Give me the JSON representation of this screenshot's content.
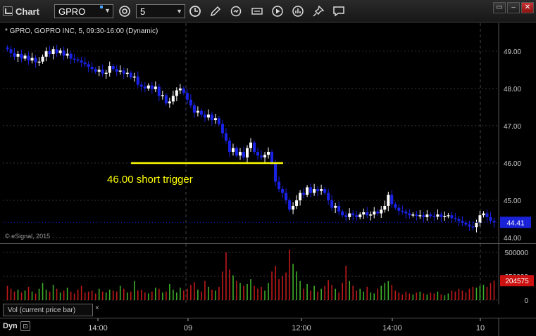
{
  "toolbar": {
    "title": "Chart",
    "symbol": "GPRO",
    "interval": "5",
    "icons": [
      "chart-icon",
      "link-settings-icon",
      "clock-icon",
      "pencil-draw-icon",
      "refresh-icon",
      "edit-label-icon",
      "play-icon",
      "bar-chart-icon",
      "pin-icon",
      "comment-icon"
    ],
    "window_buttons": [
      "restore",
      "minimize",
      "close"
    ]
  },
  "chart": {
    "heading": "* GPRO, GOPRO INC, 5, 09:30-16:00 (Dynamic)",
    "copyright": "© eSignal, 2015",
    "annotation": "46.00 short trigger",
    "annotation_color": "#ffff00",
    "trigger_price": 46.0,
    "last_price_label": "44.41",
    "last_price_color": "#1a22d8",
    "up_color": "#ffffff",
    "down_color": "#1a22e6"
  },
  "volume": {
    "label": "Vol (current price bar)",
    "close_symbol": "×",
    "last_volume_label": "204575",
    "last_volume_color": "#cc1111"
  },
  "time_axis": {
    "mode": "Dyn",
    "ticks": [
      "14:00",
      "09",
      "12:00",
      "14:00",
      "10"
    ]
  },
  "chart_data": [
    {
      "type": "candlestick",
      "title": "* GPRO, GOPRO INC, 5, 09:30-16:00 (Dynamic)",
      "ylabel": "",
      "ylim": [
        44.0,
        49.5
      ],
      "y_ticks": [
        49.0,
        48.0,
        47.0,
        46.0,
        45.0,
        44.0
      ],
      "x_ticks": [
        "14:00",
        "09",
        "12:00",
        "14:00",
        "10"
      ],
      "grid": true,
      "close": [
        49.05,
        48.95,
        48.85,
        48.92,
        48.8,
        48.88,
        48.75,
        48.82,
        48.7,
        48.72,
        48.85,
        49.0,
        48.92,
        49.05,
        48.95,
        49.02,
        48.88,
        48.93,
        48.8,
        48.78,
        48.75,
        48.7,
        48.65,
        48.58,
        48.52,
        48.45,
        48.5,
        48.4,
        48.42,
        48.6,
        48.52,
        48.45,
        48.48,
        48.4,
        48.42,
        48.3,
        48.32,
        48.1,
        48.05,
        48.0,
        48.08,
        47.98,
        48.05,
        47.8,
        47.82,
        47.6,
        47.65,
        47.8,
        47.95,
        48.0,
        47.88,
        47.7,
        47.55,
        47.35,
        47.4,
        47.3,
        47.22,
        47.3,
        47.15,
        47.2,
        47.05,
        46.8,
        46.6,
        46.3,
        46.4,
        46.2,
        46.3,
        46.15,
        46.4,
        46.55,
        46.3,
        46.2,
        46.15,
        46.22,
        46.3,
        46.0,
        45.5,
        45.3,
        45.2,
        45.0,
        44.75,
        44.85,
        45.0,
        45.2,
        45.15,
        45.35,
        45.2,
        45.3,
        45.25,
        45.3,
        45.2,
        45.0,
        44.8,
        44.85,
        44.7,
        44.6,
        44.55,
        44.65,
        44.6,
        44.55,
        44.62,
        44.68,
        44.6,
        44.62,
        44.7,
        44.65,
        44.75,
        44.85,
        45.15,
        44.9,
        44.8,
        44.72,
        44.7,
        44.65,
        44.6,
        44.62,
        44.58,
        44.6,
        44.55,
        44.62,
        44.58,
        44.56,
        44.62,
        44.55,
        44.58,
        44.6,
        44.52,
        44.5,
        44.45,
        44.4,
        44.35,
        44.3,
        44.28,
        44.4,
        44.6,
        44.65,
        44.55,
        44.45,
        44.41
      ],
      "volume": [
        150000,
        120000,
        90000,
        110000,
        80000,
        100000,
        140000,
        90000,
        70000,
        120000,
        180000,
        110000,
        90000,
        160000,
        120000,
        80000,
        100000,
        130000,
        90000,
        70000,
        110000,
        150000,
        80000,
        90000,
        100000,
        70000,
        120000,
        90000,
        80000,
        110000,
        100000,
        90000,
        150000,
        120000,
        80000,
        90000,
        200000,
        100000,
        110000,
        80000,
        70000,
        90000,
        130000,
        120000,
        80000,
        90000,
        170000,
        110000,
        80000,
        130000,
        100000,
        120000,
        160000,
        190000,
        110000,
        90000,
        200000,
        140000,
        110000,
        100000,
        140000,
        300000,
        500000,
        320000,
        260000,
        200000,
        180000,
        150000,
        170000,
        220000,
        150000,
        120000,
        140000,
        100000,
        180000,
        300000,
        360000,
        220000,
        250000,
        290000,
        530000,
        380000,
        300000,
        200000,
        120000,
        170000,
        100000,
        150000,
        90000,
        120000,
        150000,
        210000,
        160000,
        120000,
        80000,
        180000,
        360000,
        200000,
        150000,
        100000,
        120000,
        90000,
        140000,
        80000,
        70000,
        120000,
        150000,
        180000,
        200000,
        160000,
        100000,
        80000,
        60000,
        90000,
        70000,
        60000,
        80000,
        90000,
        70000,
        60000,
        80000,
        70000,
        90000,
        60000,
        50000,
        70000,
        100000,
        90000,
        120000,
        100000,
        80000,
        120000,
        140000,
        130000,
        150000,
        160000,
        140000,
        180000,
        204575
      ],
      "volume_ylim": [
        0,
        560000
      ],
      "volume_ticks": [
        500000,
        250000,
        0
      ]
    }
  ]
}
